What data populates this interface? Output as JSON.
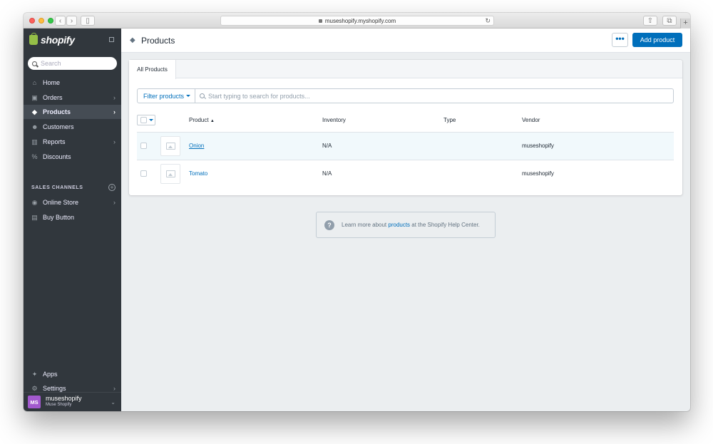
{
  "browser": {
    "url": "museshopify.myshopify.com",
    "back_icon": "chevron-left",
    "forward_icon": "chevron-right",
    "sidebar_toggle_icon": "sidebar",
    "share_icon": "share",
    "tabs_icon": "tabs",
    "new_tab_label": "+"
  },
  "sidebar": {
    "logo_text": "shopify",
    "search_placeholder": "Search",
    "items": [
      {
        "label": "Home",
        "icon": "home-icon"
      },
      {
        "label": "Orders",
        "icon": "orders-icon"
      },
      {
        "label": "Products",
        "icon": "tag-icon"
      },
      {
        "label": "Customers",
        "icon": "customers-icon"
      },
      {
        "label": "Reports",
        "icon": "bar-chart-icon"
      },
      {
        "label": "Discounts",
        "icon": "discount-icon"
      }
    ],
    "sales_channels_label": "SALES CHANNELS",
    "channels": [
      {
        "label": "Online Store",
        "icon": "store-icon"
      },
      {
        "label": "Buy Button",
        "icon": "buy-button-icon"
      }
    ],
    "bottom_items": [
      {
        "label": "Apps",
        "icon": "apps-icon"
      },
      {
        "label": "Settings",
        "icon": "gear-icon"
      }
    ],
    "account": {
      "initials": "MS",
      "name": "museshopify",
      "store": "Muse Shopify"
    }
  },
  "header": {
    "title": "Products",
    "more_label": "•••",
    "add_button": "Add product"
  },
  "products": {
    "tab": "All Products",
    "filter_label": "Filter products",
    "search_placeholder": "Start typing to search for products...",
    "columns": [
      "Product",
      "Inventory",
      "Type",
      "Vendor"
    ],
    "rows": [
      {
        "name": "Onion",
        "inventory": "N/A",
        "type": "",
        "vendor": "museshopify"
      },
      {
        "name": "Tomato",
        "inventory": "N/A",
        "type": "",
        "vendor": "museshopify"
      }
    ]
  },
  "help": {
    "prefix": "Learn more about ",
    "link": "products",
    "suffix": " at the Shopify Help Center."
  },
  "colors": {
    "sidebar_bg": "#31373d",
    "accent": "#006fbb",
    "highlight_row": "#f1f9fc"
  }
}
